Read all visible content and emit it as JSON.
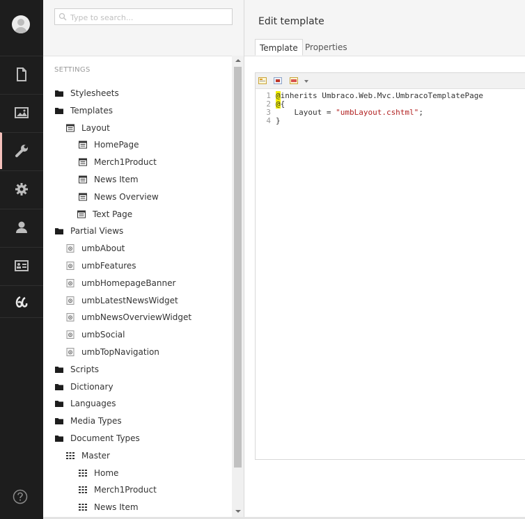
{
  "search": {
    "placeholder": "Type to search..."
  },
  "tree": {
    "section_title": "SETTINGS",
    "items": [
      {
        "label": "Stylesheets",
        "icon": "folder-icon",
        "indent": 0
      },
      {
        "label": "Templates",
        "icon": "folder-icon",
        "indent": 0
      },
      {
        "label": "Layout",
        "icon": "template-icon",
        "indent": 1
      },
      {
        "label": "HomePage",
        "icon": "template-icon",
        "indent": 2
      },
      {
        "label": "Merch1Product",
        "icon": "template-icon",
        "indent": 2
      },
      {
        "label": "News Item",
        "icon": "template-icon",
        "indent": 2
      },
      {
        "label": "News Overview",
        "icon": "template-icon",
        "indent": 2
      },
      {
        "label": "Text Page",
        "icon": "template-icon",
        "indent": 2
      },
      {
        "label": "Partial Views",
        "icon": "folder-icon",
        "indent": 0
      },
      {
        "label": "umbAbout",
        "icon": "partial-view-icon",
        "indent": 1
      },
      {
        "label": "umbFeatures",
        "icon": "partial-view-icon",
        "indent": 1
      },
      {
        "label": "umbHomepageBanner",
        "icon": "partial-view-icon",
        "indent": 1
      },
      {
        "label": "umbLatestNewsWidget",
        "icon": "partial-view-icon",
        "indent": 1
      },
      {
        "label": "umbNewsOverviewWidget",
        "icon": "partial-view-icon",
        "indent": 1
      },
      {
        "label": "umbSocial",
        "icon": "partial-view-icon",
        "indent": 1
      },
      {
        "label": "umbTopNavigation",
        "icon": "partial-view-icon",
        "indent": 1
      },
      {
        "label": "Scripts",
        "icon": "folder-icon",
        "indent": 0
      },
      {
        "label": "Dictionary",
        "icon": "folder-icon",
        "indent": 0
      },
      {
        "label": "Languages",
        "icon": "folder-icon",
        "indent": 0
      },
      {
        "label": "Media Types",
        "icon": "folder-icon",
        "indent": 0
      },
      {
        "label": "Document Types",
        "icon": "folder-icon",
        "indent": 0
      },
      {
        "label": "Master",
        "icon": "doctype-icon",
        "indent": 1
      },
      {
        "label": "Home",
        "icon": "doctype-icon",
        "indent": 2
      },
      {
        "label": "Merch1Product",
        "icon": "doctype-icon",
        "indent": 2
      },
      {
        "label": "News Item",
        "icon": "doctype-icon",
        "indent": 2
      }
    ]
  },
  "editor": {
    "title": "Edit template",
    "tabs": [
      "Template",
      "Properties"
    ],
    "active_tab": "Template",
    "code_lines": [
      {
        "num": "1",
        "parts": [
          {
            "t": "@",
            "c": "hl"
          },
          {
            "t": "inherits Umbraco.Web.Mvc.UmbracoTemplatePage",
            "c": ""
          }
        ]
      },
      {
        "num": "2",
        "parts": [
          {
            "t": "@",
            "c": "hl"
          },
          {
            "t": "{",
            "c": ""
          }
        ]
      },
      {
        "num": "3",
        "parts": [
          {
            "t": "    Layout = ",
            "c": ""
          },
          {
            "t": "\"umbLayout.cshtml\"",
            "c": "str"
          },
          {
            "t": ";",
            "c": ""
          }
        ]
      },
      {
        "num": "4",
        "parts": [
          {
            "t": "}",
            "c": ""
          }
        ]
      }
    ]
  },
  "colors": {
    "rail_bg": "#1d1d1d",
    "rail_active_indicator": "#f5c1bc",
    "highlight": "#f3f000",
    "string": "#b22222"
  },
  "rail": {
    "items": [
      "content-icon",
      "media-icon",
      "settings-wrench-icon",
      "developer-gear-icon",
      "users-icon",
      "members-icon",
      "forms-icon"
    ],
    "active": "settings-wrench-icon",
    "help_icon": "help-icon"
  }
}
